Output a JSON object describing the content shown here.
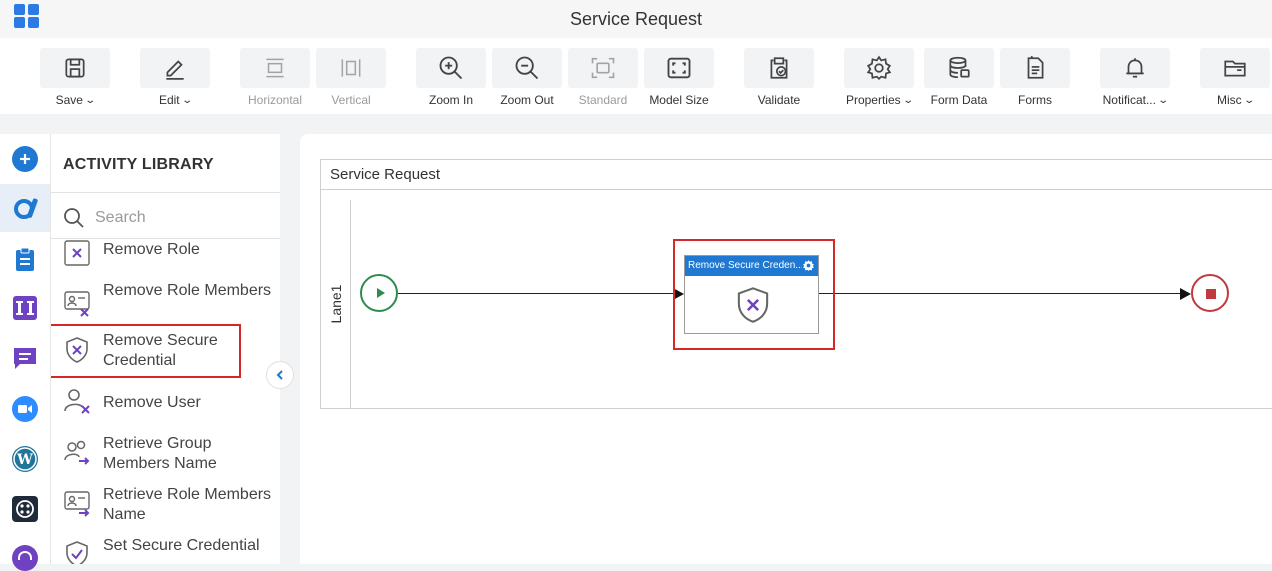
{
  "app": {
    "title": "Service Request"
  },
  "toolbar": [
    {
      "label": "Save",
      "icon": "save-icon",
      "dropdown": true,
      "enabled": true
    },
    {
      "label": "Edit",
      "icon": "edit-icon",
      "dropdown": true,
      "enabled": true
    },
    {
      "label": "Horizontal",
      "icon": "horizontal-icon",
      "dropdown": false,
      "enabled": false
    },
    {
      "label": "Vertical",
      "icon": "vertical-icon",
      "dropdown": false,
      "enabled": false
    },
    {
      "label": "Zoom In",
      "icon": "zoom-in-icon",
      "dropdown": false,
      "enabled": true
    },
    {
      "label": "Zoom Out",
      "icon": "zoom-out-icon",
      "dropdown": false,
      "enabled": true
    },
    {
      "label": "Standard",
      "icon": "standard-icon",
      "dropdown": false,
      "enabled": false
    },
    {
      "label": "Model Size",
      "icon": "model-size-icon",
      "dropdown": false,
      "enabled": true
    },
    {
      "label": "Validate",
      "icon": "validate-icon",
      "dropdown": false,
      "enabled": true
    },
    {
      "label": "Properties",
      "icon": "gear-icon",
      "dropdown": true,
      "enabled": true
    },
    {
      "label": "Form Data",
      "icon": "database-icon",
      "dropdown": false,
      "enabled": true
    },
    {
      "label": "Forms",
      "icon": "forms-icon",
      "dropdown": false,
      "enabled": true
    },
    {
      "label": "Notificat...",
      "icon": "bell-icon",
      "dropdown": true,
      "enabled": true
    },
    {
      "label": "Misc",
      "icon": "folder-icon",
      "dropdown": true,
      "enabled": true
    }
  ],
  "rail": [
    {
      "icon": "add-icon",
      "color": "#1f78d1"
    },
    {
      "icon": "activity-library-icon",
      "color": "#1f78d1",
      "active": true
    },
    {
      "icon": "clipboard-icon",
      "color": "#1f78d1"
    },
    {
      "icon": "integration-icon",
      "color": "#6f42c1"
    },
    {
      "icon": "chat-icon",
      "color": "#6f42c1"
    },
    {
      "icon": "video-icon",
      "color": "#2d8cff"
    },
    {
      "icon": "wordpress-icon",
      "color": "#21759b"
    },
    {
      "icon": "dial-icon",
      "color": "#1e2a38"
    },
    {
      "icon": "support-icon",
      "color": "#6f42c1"
    }
  ],
  "library": {
    "title": "ACTIVITY LIBRARY",
    "search_placeholder": "Search",
    "items": [
      {
        "label": "Remove Role",
        "icon": "remove-role-icon"
      },
      {
        "label": "Remove Role Members",
        "icon": "remove-role-members-icon"
      },
      {
        "label": "Remove Secure Credential",
        "icon": "remove-secure-credential-icon",
        "selected": true
      },
      {
        "label": "Remove User",
        "icon": "remove-user-icon"
      },
      {
        "label": "Retrieve Group Members Name",
        "icon": "retrieve-group-members-icon"
      },
      {
        "label": "Retrieve Role Members Name",
        "icon": "retrieve-role-members-icon"
      },
      {
        "label": "Set Secure Credential",
        "icon": "set-secure-credential-icon"
      }
    ]
  },
  "diagram": {
    "pool_title": "Service Request",
    "lane_label": "Lane1",
    "task_label": "Remove Secure Creden...",
    "colors": {
      "start": "#2e8b4e",
      "end": "#c0393f",
      "task_header": "#1f78d1",
      "highlight": "#d62828"
    }
  }
}
